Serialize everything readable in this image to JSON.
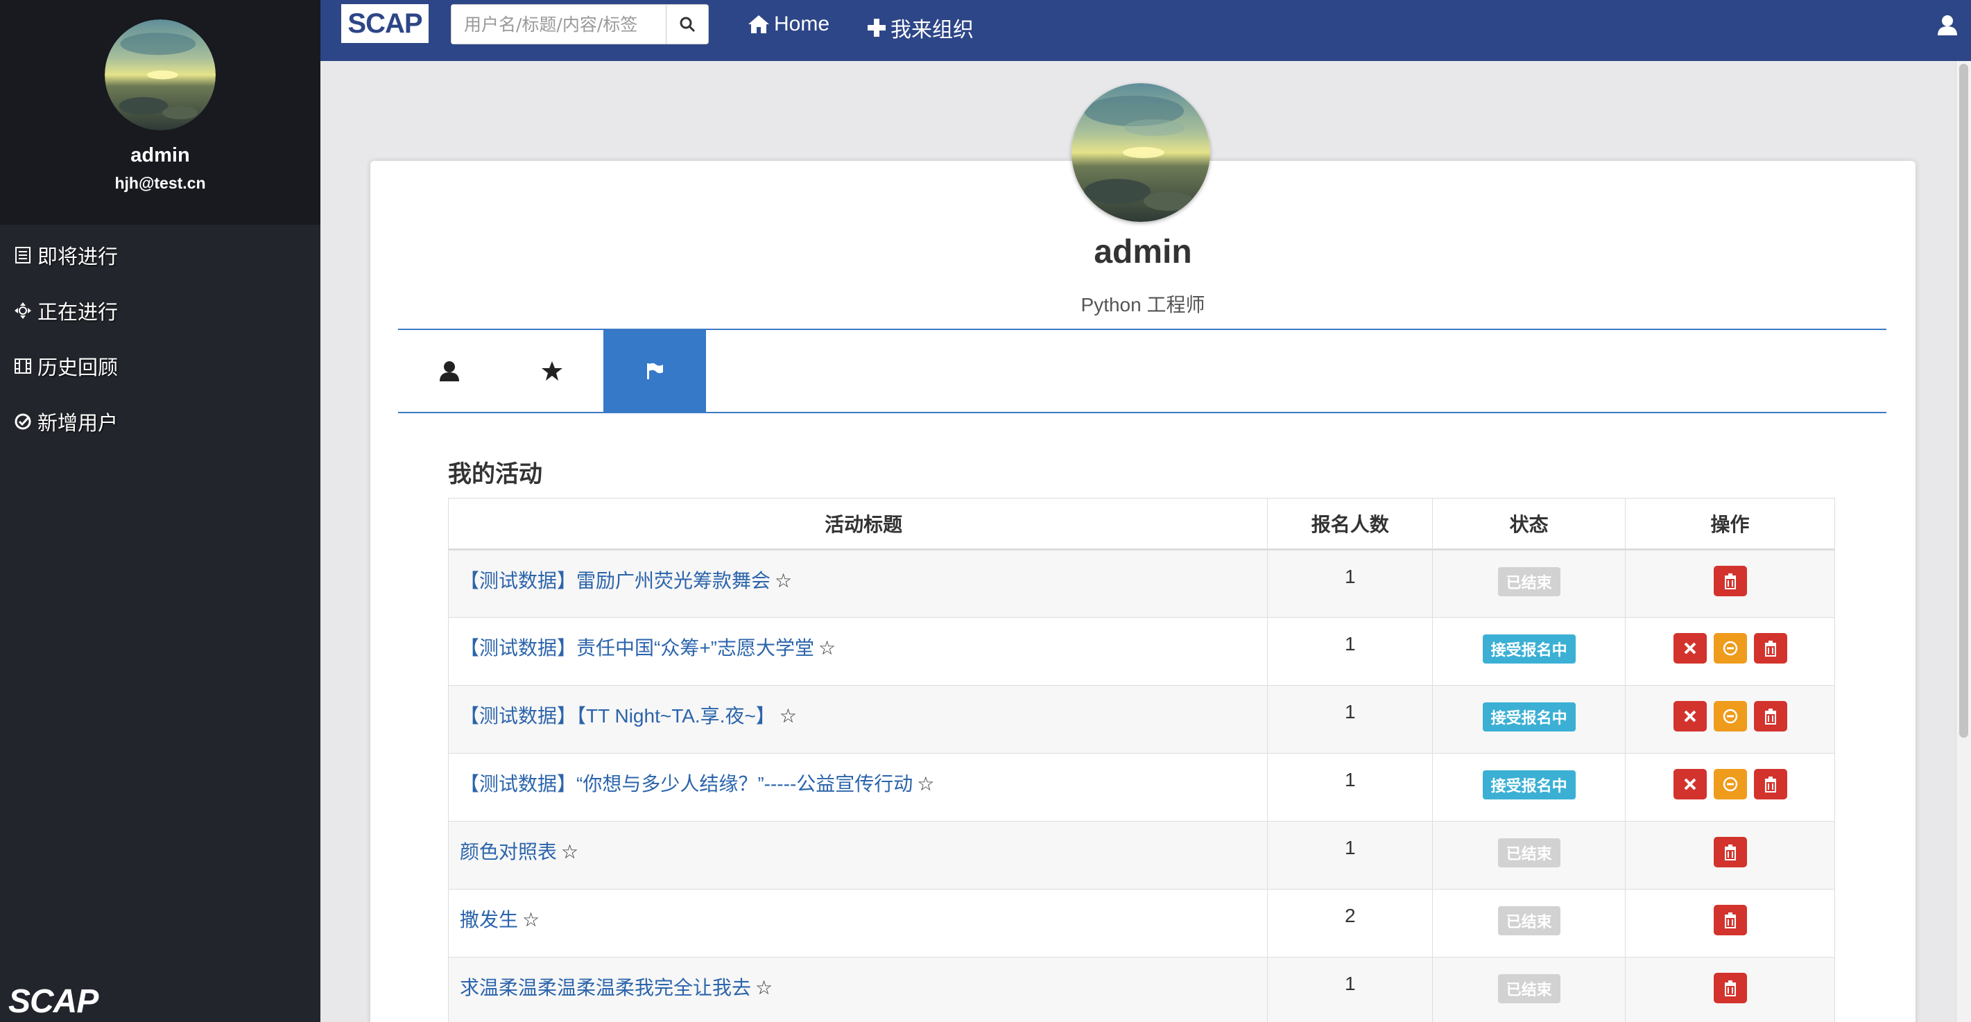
{
  "sidebar": {
    "user_name": "admin",
    "user_email": "hjh@test.cn",
    "items": [
      {
        "label": "即将进行",
        "icon": "list-icon"
      },
      {
        "label": "正在进行",
        "icon": "move-icon"
      },
      {
        "label": "历史回顾",
        "icon": "film-icon"
      },
      {
        "label": "新增用户",
        "icon": "check-circle-icon"
      }
    ],
    "logo": "SCAP"
  },
  "nav": {
    "brand": "SCAP",
    "search_placeholder": "用户名/标题/内容/标签",
    "home_label": "Home",
    "organize_label": "我来组织"
  },
  "profile": {
    "name": "admin",
    "title": "Python 工程师"
  },
  "tabs": [
    {
      "icon": "user-icon",
      "active": false
    },
    {
      "icon": "star-icon",
      "active": false
    },
    {
      "icon": "flag-icon",
      "active": true
    }
  ],
  "activities": {
    "section_title": "我的活动",
    "headers": [
      "活动标题",
      "报名人数",
      "状态",
      "操作"
    ],
    "rows": [
      {
        "title": "【测试数据】雷励广州荧光筹款舞会",
        "count": "1",
        "status": "已结束",
        "status_type": "ended"
      },
      {
        "title": "【测试数据】责任中国“众筹+”志愿大学堂",
        "count": "1",
        "status": "接受报名中",
        "status_type": "open"
      },
      {
        "title": "【测试数据】【TT Night~TA.享.夜~】",
        "count": "1",
        "status": "接受报名中",
        "status_type": "open"
      },
      {
        "title": "【测试数据】“你想与多少人结缘？”-----公益宣传行动",
        "count": "1",
        "status": "接受报名中",
        "status_type": "open"
      },
      {
        "title": "颜色对照表",
        "count": "1",
        "status": "已结束",
        "status_type": "ended"
      },
      {
        "title": "撒发生",
        "count": "2",
        "status": "已结束",
        "status_type": "ended"
      },
      {
        "title": "求温柔温柔温柔温柔我完全让我去",
        "count": "1",
        "status": "已结束",
        "status_type": "ended"
      }
    ],
    "star_glyph": "☆"
  },
  "colors": {
    "nav_bg": "#2d4687",
    "sidebar_bg": "#22252b",
    "tab_active": "#3579c8",
    "badge_open": "#3bb0d4",
    "badge_ended": "#d2d2d2",
    "btn_danger": "#d3332d",
    "btn_warning": "#ef9b1c"
  }
}
